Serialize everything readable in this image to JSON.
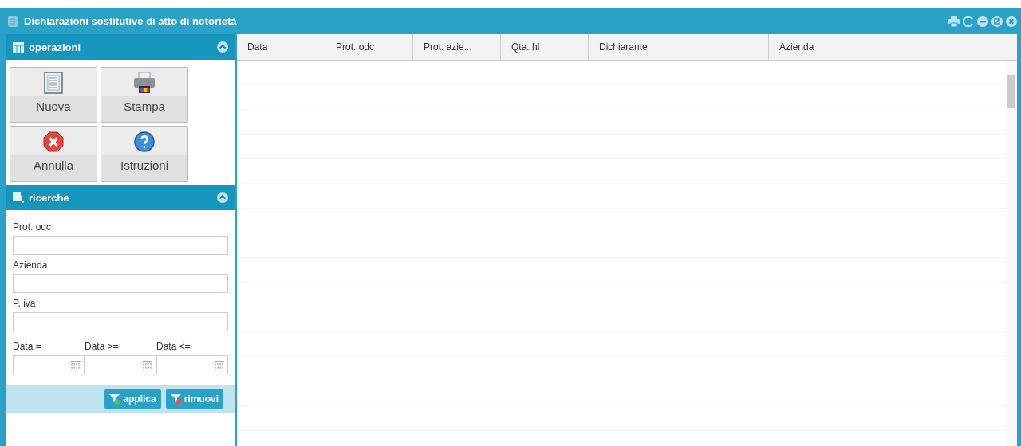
{
  "window": {
    "title": "Dichiarazioni sostitutive di atto di notorietà"
  },
  "operations": {
    "title": "operazioni",
    "expanded": true,
    "buttons": [
      {
        "label": "Nuova",
        "kind": "document"
      },
      {
        "label": "Stampa",
        "kind": "printer"
      },
      {
        "label": "Annulla",
        "kind": "cancel"
      },
      {
        "label": "Istruzioni",
        "kind": "help"
      }
    ]
  },
  "search": {
    "title": "ricerche",
    "expanded": true,
    "fields": [
      {
        "label": "Prot. odc"
      },
      {
        "label": "Azienda"
      },
      {
        "label": "P. iva"
      }
    ],
    "date_fields": [
      {
        "label": "Data ="
      },
      {
        "label": "Data >="
      },
      {
        "label": "Data <="
      }
    ],
    "buttons": [
      {
        "label": "applica",
        "kind": "add"
      },
      {
        "label": "rimuovi",
        "kind": "remove"
      }
    ]
  },
  "table": {
    "columns": [
      "Data",
      "Prot. odc",
      "Prot. azie...",
      "Qta. hl",
      "Dichiarante",
      "Azienda"
    ]
  }
}
